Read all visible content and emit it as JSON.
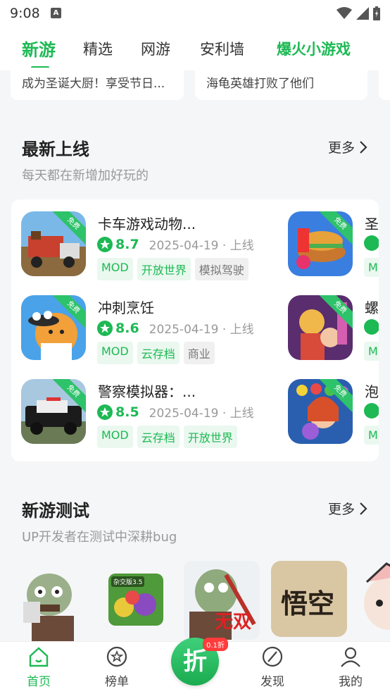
{
  "status": {
    "time": "9:08",
    "notif_letter": "A"
  },
  "tabs": [
    {
      "label": "新游"
    },
    {
      "label": "精选"
    },
    {
      "label": "网游"
    },
    {
      "label": "安利墙"
    },
    {
      "label": "爆火小游戏"
    }
  ],
  "promos": [
    {
      "text": "成为圣诞大厨！享受节日..."
    },
    {
      "text": "海龟英雄打败了他们"
    }
  ],
  "new_section": {
    "title": "最新上线",
    "subtitle": "每天都在新增加好玩的",
    "more": "更多"
  },
  "free_label": "免费",
  "games": [
    {
      "name": "卡车游戏动物...",
      "score": "8.7",
      "date": "2025-04-19 · 上线",
      "tags": [
        "MOD",
        "开放世界",
        "模拟驾驶"
      ]
    },
    {
      "name": "冲刺烹饪",
      "score": "8.6",
      "date": "2025-04-19 · 上线",
      "tags": [
        "MOD",
        "云存档",
        "商业"
      ]
    },
    {
      "name": "警察模拟器：...",
      "score": "8.5",
      "date": "2025-04-19 · 上线",
      "tags": [
        "MOD",
        "云存档",
        "开放世界"
      ]
    }
  ],
  "right_games": [
    {
      "name": "圣",
      "tag": "M"
    },
    {
      "name": "螺",
      "tag": "M"
    },
    {
      "name": "泡",
      "tag": "M"
    }
  ],
  "test_section": {
    "title": "新游测试",
    "subtitle": "UP开发者在测试中深耕bug",
    "more": "更多"
  },
  "test_items": [
    {
      "label": ""
    },
    {
      "label": "杂交版3.5"
    },
    {
      "label": "无双"
    },
    {
      "label": "悟空"
    },
    {
      "label": ""
    }
  ],
  "nav": [
    {
      "label": "首页"
    },
    {
      "label": "榜单"
    },
    {
      "label": "折"
    },
    {
      "label": "发现"
    },
    {
      "label": "我的"
    }
  ],
  "zhe_badge": "0.1折",
  "colors": {
    "accent": "#1db954",
    "tag_bg": "#eaf8ef",
    "badge": "#ff3b3b"
  }
}
